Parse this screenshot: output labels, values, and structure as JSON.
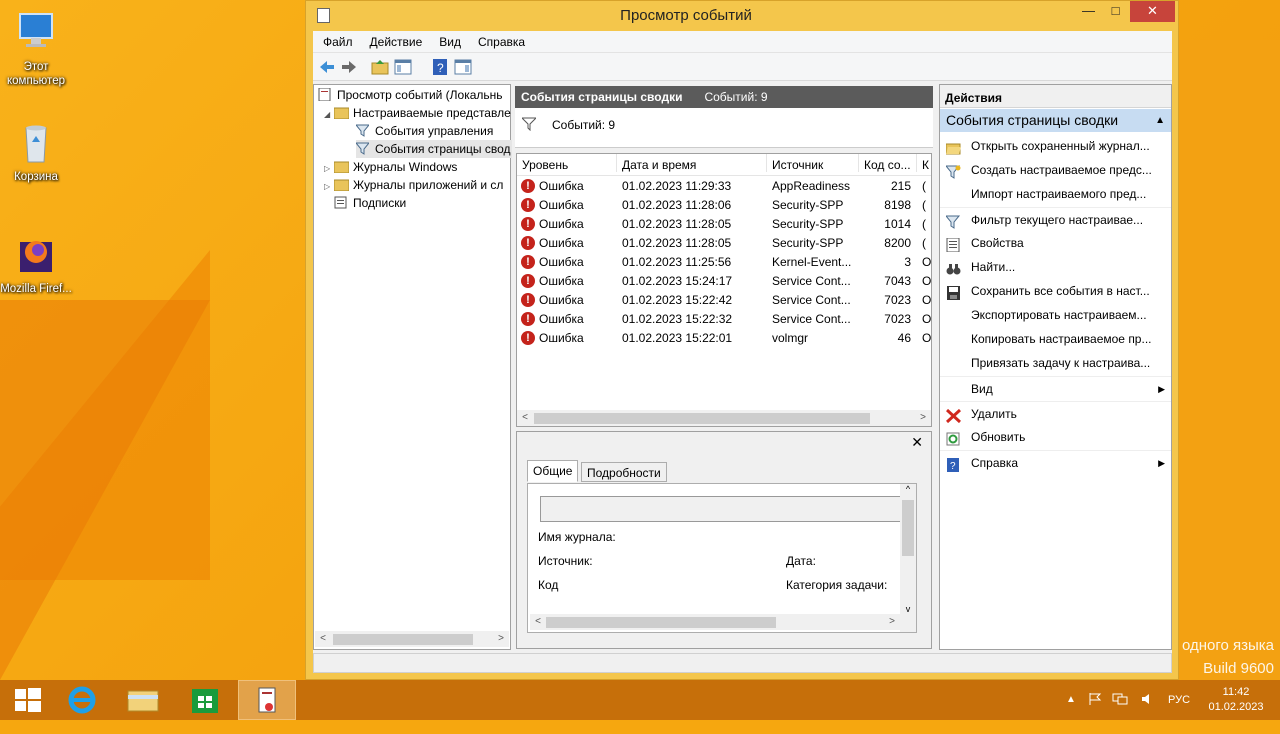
{
  "desktop": {
    "icons": [
      {
        "label": "Этот компьютер"
      },
      {
        "label": "Корзина"
      },
      {
        "label": "Mozilla Firef..."
      }
    ],
    "watermark": [
      "одного языка",
      "Build 9600"
    ]
  },
  "window": {
    "title": "Просмотр событий",
    "controls": {
      "minimize": "—",
      "maximize": "□",
      "close": "✕"
    }
  },
  "menu": [
    "Файл",
    "Действие",
    "Вид",
    "Справка"
  ],
  "tree": {
    "items": [
      {
        "label": "Просмотр событий (Локальнь",
        "twisty": ""
      },
      {
        "label": "Настраиваемые представле",
        "twisty": "◢"
      },
      {
        "label": "События управления",
        "twisty": ""
      },
      {
        "label": "События страницы свод",
        "twisty": ""
      },
      {
        "label": "Журналы Windows",
        "twisty": "▷"
      },
      {
        "label": "Журналы приложений и сл",
        "twisty": "▷"
      },
      {
        "label": "Подписки",
        "twisty": ""
      }
    ]
  },
  "summary": {
    "title": "События страницы сводки",
    "count_label": "Событий: 9",
    "filter_text": "Событий: 9"
  },
  "grid": {
    "columns": [
      "Уровень",
      "Дата и время",
      "Источник",
      "Код со...",
      "К"
    ],
    "rows": [
      {
        "level": "Ошибка",
        "datetime": "01.02.2023 11:29:33",
        "source": "AppReadiness",
        "code": "215",
        "cat": "("
      },
      {
        "level": "Ошибка",
        "datetime": "01.02.2023 11:28:06",
        "source": "Security-SPP",
        "code": "8198",
        "cat": "("
      },
      {
        "level": "Ошибка",
        "datetime": "01.02.2023 11:28:05",
        "source": "Security-SPP",
        "code": "1014",
        "cat": "("
      },
      {
        "level": "Ошибка",
        "datetime": "01.02.2023 11:28:05",
        "source": "Security-SPP",
        "code": "8200",
        "cat": "("
      },
      {
        "level": "Ошибка",
        "datetime": "01.02.2023 11:25:56",
        "source": "Kernel-Event...",
        "code": "3",
        "cat": "O"
      },
      {
        "level": "Ошибка",
        "datetime": "01.02.2023 15:24:17",
        "source": "Service Cont...",
        "code": "7043",
        "cat": "O"
      },
      {
        "level": "Ошибка",
        "datetime": "01.02.2023 15:22:42",
        "source": "Service Cont...",
        "code": "7023",
        "cat": "O"
      },
      {
        "level": "Ошибка",
        "datetime": "01.02.2023 15:22:32",
        "source": "Service Cont...",
        "code": "7023",
        "cat": "O"
      },
      {
        "level": "Ошибка",
        "datetime": "01.02.2023 15:22:01",
        "source": "volmgr",
        "code": "46",
        "cat": "O"
      }
    ]
  },
  "detail": {
    "close": "✕",
    "tabs": [
      "Общие",
      "Подробности"
    ],
    "labels": {
      "log_name": "Имя журнала:",
      "source": "Источник:",
      "date": "Дата:",
      "code": "Код",
      "task_category": "Категория задачи:"
    }
  },
  "actions": {
    "header": "Действия",
    "section": "События страницы сводки",
    "items": [
      {
        "label": "Открыть сохраненный журнал...",
        "icon": "folder-open-icon"
      },
      {
        "label": "Создать настраиваемое предс...",
        "icon": "filter-new-icon"
      },
      {
        "label": "Импорт настраиваемого пред...",
        "icon": ""
      },
      {
        "label": "Фильтр текущего настраивае...",
        "icon": "filter-icon"
      },
      {
        "label": "Свойства",
        "icon": "properties-icon"
      },
      {
        "label": "Найти...",
        "icon": "binoculars-icon"
      },
      {
        "label": "Сохранить все события в наст...",
        "icon": "save-icon"
      },
      {
        "label": "Экспортировать настраиваем...",
        "icon": ""
      },
      {
        "label": "Копировать настраиваемое пр...",
        "icon": ""
      },
      {
        "label": "Привязать задачу к настраива...",
        "icon": ""
      },
      {
        "label": "Вид",
        "icon": "",
        "submenu": "▶"
      },
      {
        "label": "Удалить",
        "icon": "delete-icon"
      },
      {
        "label": "Обновить",
        "icon": "refresh-icon"
      },
      {
        "label": "Справка",
        "icon": "help-icon",
        "submenu": "▶"
      }
    ]
  },
  "taskbar": {
    "lang": "РУС",
    "time": "11:42",
    "date": "01.02.2023"
  },
  "colors": {
    "accent": "#f4c64b",
    "error": "#c4231b",
    "section": "#c7dcf2",
    "close": "#c7443b"
  }
}
